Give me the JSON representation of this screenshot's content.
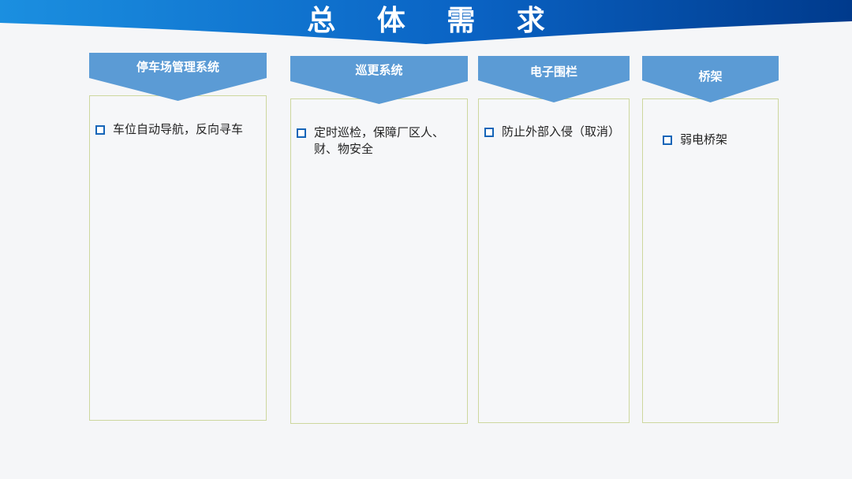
{
  "page": {
    "title": "总 体 需 求",
    "accent": "#1565b8",
    "header_color": "#5b9bd5",
    "border_color": "#cdd79e"
  },
  "columns": [
    {
      "id": "parking",
      "label": "停车场管理系统",
      "items": [
        "车位自动导航，反向寻车"
      ]
    },
    {
      "id": "patrol",
      "label": "巡更系统",
      "items": [
        "定时巡检，保障厂区人、财、物安全"
      ]
    },
    {
      "id": "fence",
      "label": "电子围栏",
      "items": [
        "防止外部入侵（取消）"
      ]
    },
    {
      "id": "tray",
      "label": "桥架",
      "items": [
        "弱电桥架"
      ]
    }
  ]
}
